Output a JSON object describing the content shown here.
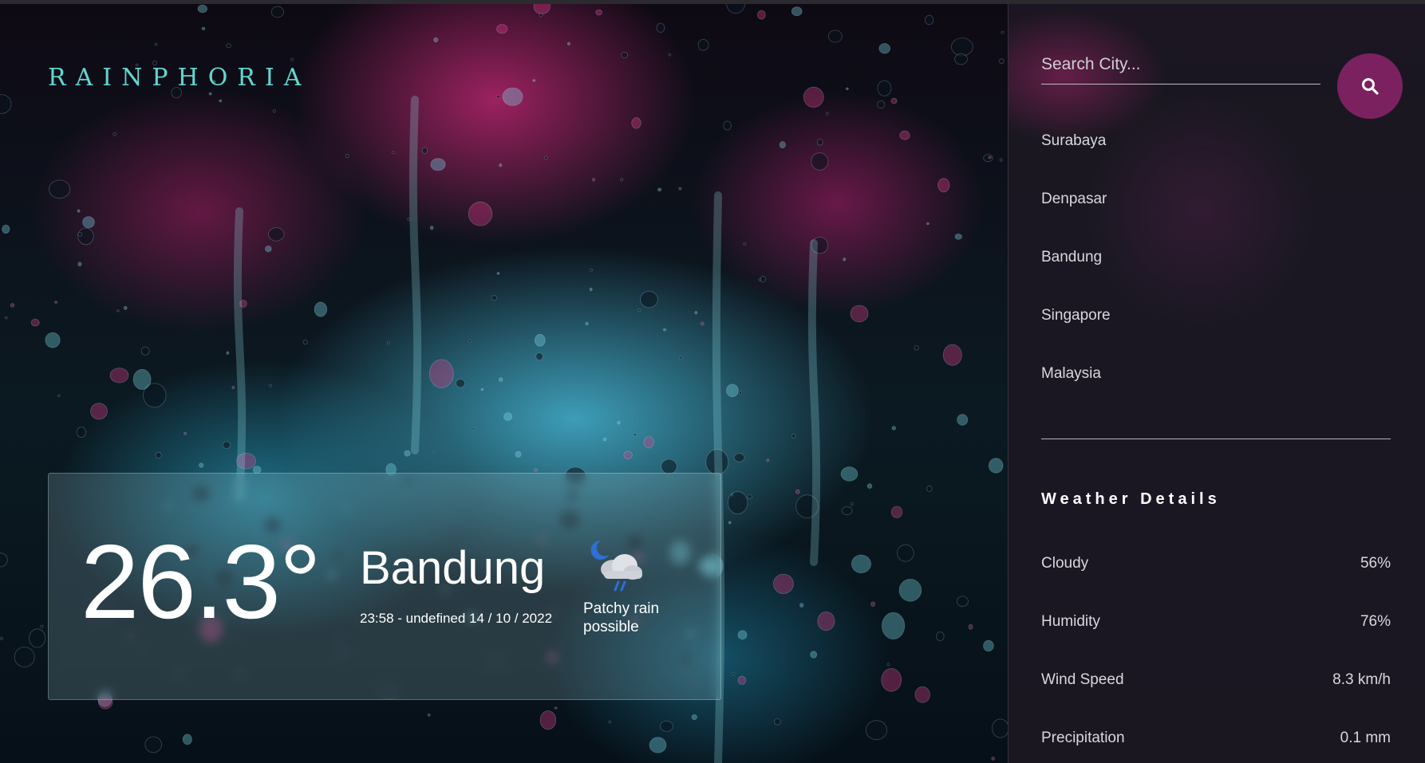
{
  "brand": {
    "logo": "RAINPHORIA"
  },
  "current": {
    "temperature": "26.3°",
    "city": "Bandung",
    "datetime": "23:58 - undefined 14 / 10 / 2022",
    "condition": "Patchy rain possible",
    "condition_icon": "moon-cloud-rain-icon"
  },
  "search": {
    "placeholder": "Search City...",
    "value": "",
    "button_icon": "search-icon"
  },
  "cities": [
    "Surabaya",
    "Denpasar",
    "Bandung",
    "Singapore",
    "Malaysia"
  ],
  "details": {
    "title": "Weather Details",
    "rows": [
      {
        "label": "Cloudy",
        "value": "56%"
      },
      {
        "label": "Humidity",
        "value": "76%"
      },
      {
        "label": "Wind Speed",
        "value": "8.3 km/h"
      },
      {
        "label": "Precipitation",
        "value": "0.1 mm"
      }
    ]
  },
  "colors": {
    "accent": "#7c2160",
    "logo": "#63d6d0",
    "panel": "#1c1822"
  }
}
